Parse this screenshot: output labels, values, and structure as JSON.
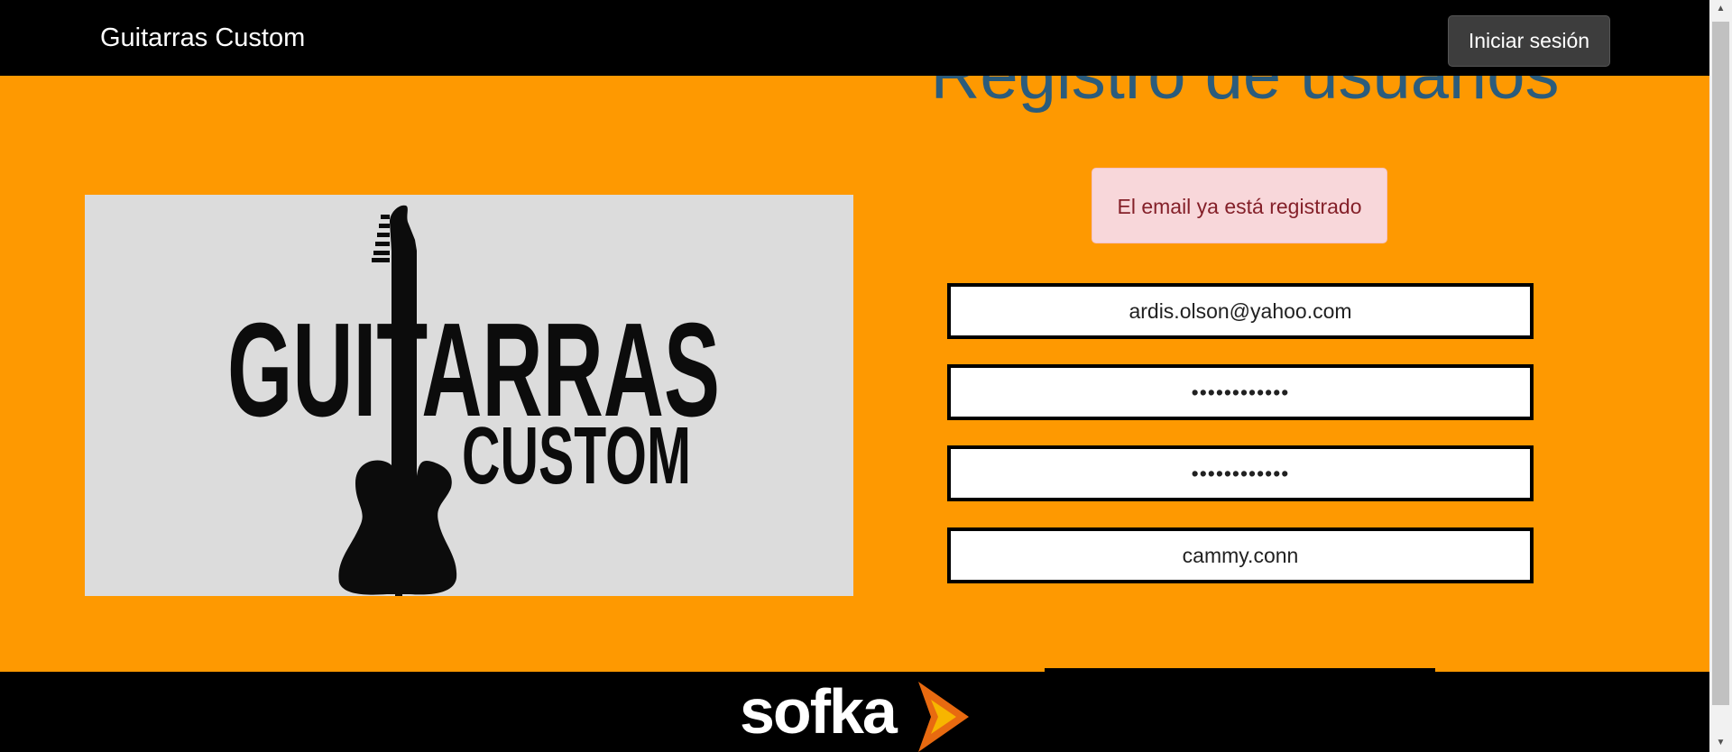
{
  "navbar": {
    "brand": "Guitarras Custom",
    "login_label": "Iniciar sesión"
  },
  "main": {
    "heading": "Registro de usuarios",
    "logo": {
      "word1": "GUITARRAS",
      "word2": "CUSTOM",
      "icon": "guitar-silhouette-icon"
    },
    "alert": "El email ya está registrado",
    "fields": {
      "email": "ardis.olson@yahoo.com",
      "password": "••••••••••••",
      "password_confirm": "••••••••••••",
      "username": "cammy.conn"
    }
  },
  "footer": {
    "brand": "sofka",
    "brand_mark": "sofka-chevron-icon"
  },
  "colors": {
    "background": "#fe9901",
    "navbar": "#000000",
    "heading": "#2b5c7c",
    "alert_bg": "#f8d7da",
    "alert_text": "#842029",
    "accent_mark": "#e86a10"
  }
}
